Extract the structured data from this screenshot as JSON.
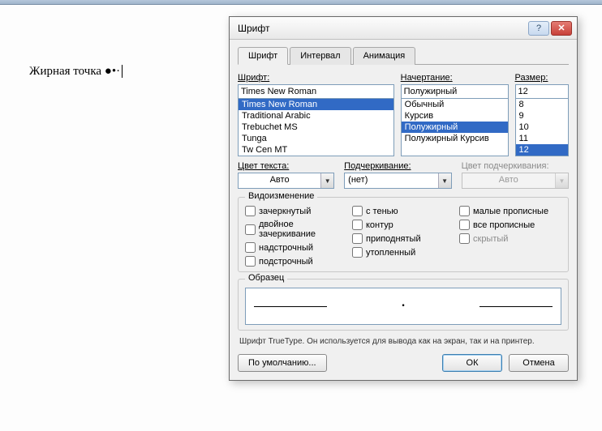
{
  "document_text": "Жирная точка ●•·",
  "dialog": {
    "title": "Шрифт",
    "tabs": [
      "Шрифт",
      "Интервал",
      "Анимация"
    ],
    "font": {
      "label": "Шрифт:",
      "value": "Times New Roman",
      "list": [
        "Times New Roman",
        "Traditional Arabic",
        "Trebuchet MS",
        "Tunga",
        "Tw Cen MT"
      ],
      "selected": "Times New Roman"
    },
    "style": {
      "label": "Начертание:",
      "value": "Полужирный",
      "list": [
        "Обычный",
        "Курсив",
        "Полужирный",
        "Полужирный Курсив"
      ],
      "selected": "Полужирный"
    },
    "size": {
      "label": "Размер:",
      "value": "12",
      "list": [
        "8",
        "9",
        "10",
        "11",
        "12"
      ],
      "selected": "12"
    },
    "color": {
      "label": "Цвет текста:",
      "value": "Авто"
    },
    "underline": {
      "label": "Подчеркивание:",
      "value": "(нет)"
    },
    "underline_color": {
      "label": "Цвет подчеркивания:",
      "value": "Авто"
    },
    "effects": {
      "label": "Видоизменение",
      "col1": [
        "зачеркнутый",
        "двойное зачеркивание",
        "надстрочный",
        "подстрочный"
      ],
      "col2": [
        "с тенью",
        "контур",
        "приподнятый",
        "утопленный"
      ],
      "col3": [
        "малые прописные",
        "все прописные",
        "скрытый"
      ]
    },
    "preview_label": "Образец",
    "preview_char": "·",
    "hint": "Шрифт TrueType. Он используется для вывода как на экран, так и на принтер.",
    "buttons": {
      "default": "По умолчанию...",
      "ok": "ОК",
      "cancel": "Отмена"
    }
  }
}
